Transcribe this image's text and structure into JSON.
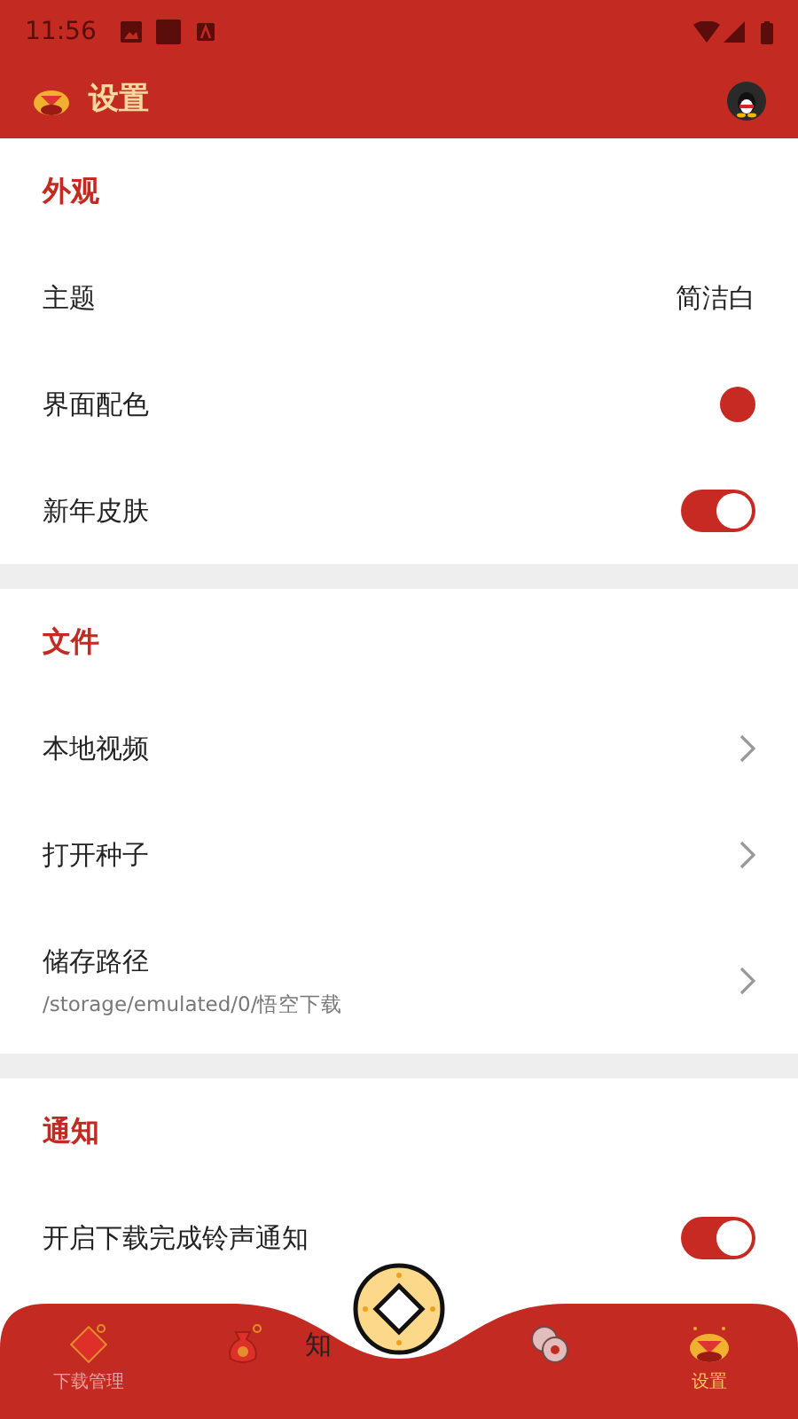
{
  "status_bar": {
    "time": "11:56"
  },
  "app_bar": {
    "title": "设置"
  },
  "sections": [
    {
      "title": "外观",
      "items": [
        {
          "kind": "value",
          "label": "主题",
          "value": "简洁白"
        },
        {
          "kind": "color",
          "label": "界面配色",
          "color": "#c62a22"
        },
        {
          "kind": "toggle",
          "label": "新年皮肤",
          "on": true
        }
      ]
    },
    {
      "title": "文件",
      "items": [
        {
          "kind": "link",
          "label": "本地视频"
        },
        {
          "kind": "link",
          "label": "打开种子"
        },
        {
          "kind": "link",
          "label": "储存路径",
          "subtitle": "/storage/emulated/0/悟空下载"
        }
      ]
    },
    {
      "title": "通知",
      "items": [
        {
          "kind": "toggle",
          "label": "开启下载完成铃声通知",
          "on": true
        },
        {
          "kind": "partial",
          "label": "知"
        }
      ]
    }
  ],
  "bottom_nav": [
    {
      "label": "下载管理",
      "selected": false
    },
    {
      "selected": false
    },
    {
      "selected": false
    },
    {
      "label": "设置",
      "selected": true
    }
  ]
}
